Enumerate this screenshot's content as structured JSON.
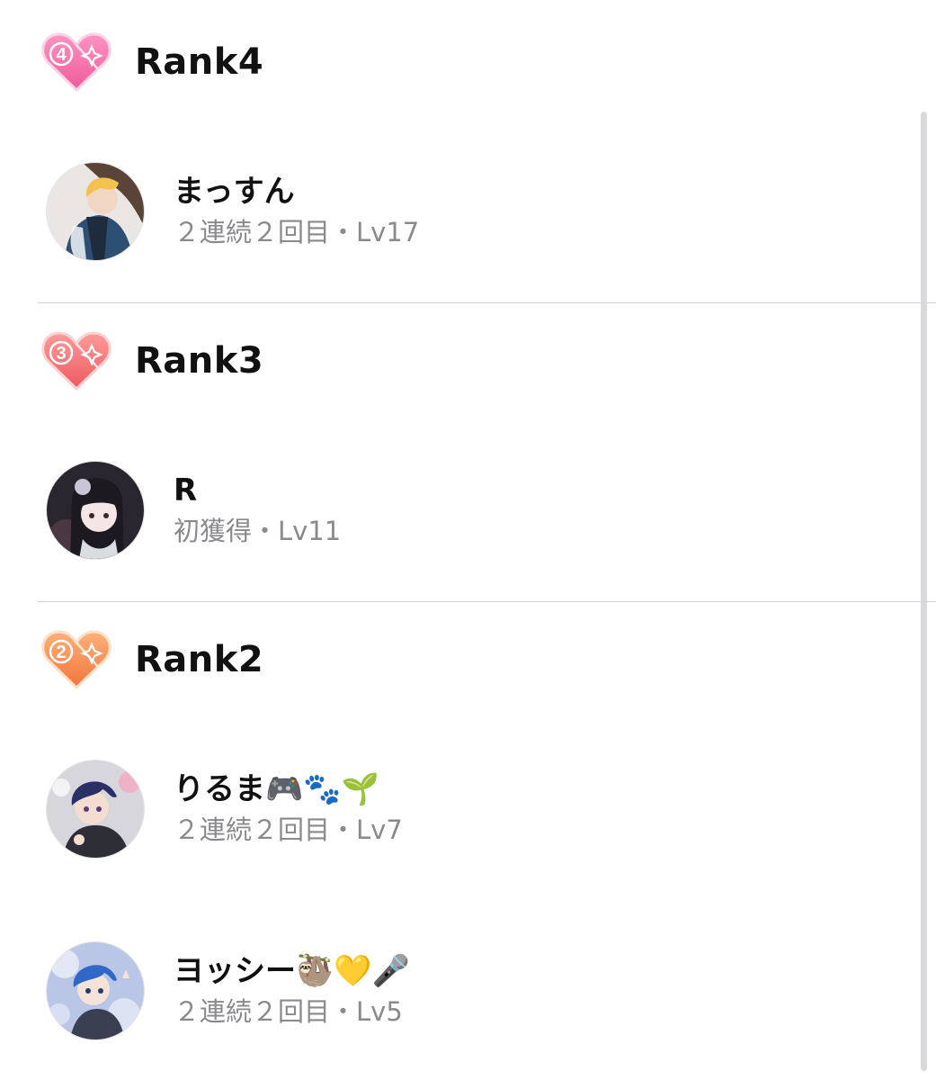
{
  "colors": {
    "rank4": "#f06aa6",
    "rank3": "#f06a6a",
    "rank2": "#f5844a",
    "name": "#111111",
    "meta": "#8a8a8e",
    "divider": "#cfcfd3"
  },
  "sections": [
    {
      "rank_label": "Rank4",
      "badge_number": "4",
      "badge_icon": "pink-heart-badge-icon",
      "users": [
        {
          "name": "まっすん",
          "meta": "２連続２回目・Lv17",
          "avatar_icon": "anime-avatar-blonde"
        }
      ]
    },
    {
      "rank_label": "Rank3",
      "badge_number": "3",
      "badge_icon": "red-heart-badge-icon",
      "users": [
        {
          "name": "R",
          "meta": "初獲得・Lv11",
          "avatar_icon": "anime-avatar-dark-hair"
        }
      ]
    },
    {
      "rank_label": "Rank2",
      "badge_number": "2",
      "badge_icon": "orange-heart-badge-icon",
      "users": [
        {
          "name": "りるま🎮🐾🌱",
          "meta": "２連続２回目・Lv7",
          "avatar_icon": "anime-avatar-navy-hair"
        },
        {
          "name": "ヨッシー🦥💛🎤",
          "meta": "２連続２回目・Lv5",
          "avatar_icon": "anime-avatar-blue-hair"
        }
      ]
    }
  ]
}
